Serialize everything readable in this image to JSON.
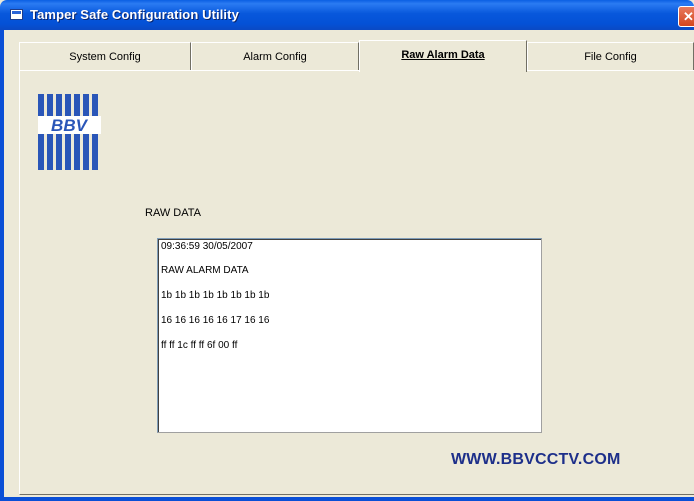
{
  "window": {
    "title": "Tamper Safe Configuration Utility",
    "close_glyph": "✕"
  },
  "tabs": [
    {
      "label": "System Config",
      "active": false
    },
    {
      "label": "Alarm Config",
      "active": false
    },
    {
      "label": "Raw Alarm Data",
      "active": true
    },
    {
      "label": "File Config",
      "active": false
    }
  ],
  "logo": {
    "text": "BBV"
  },
  "raw": {
    "label": "RAW DATA",
    "lines": [
      "09:36:59 30/05/2007",
      "RAW ALARM DATA",
      "1b 1b 1b 1b 1b 1b 1b 1b",
      "16 16 16 16 16 17 16 16",
      "ff ff 1c ff ff 6f 00 ff"
    ]
  },
  "website": "WWW.BBVCCTV.COM",
  "colors": {
    "accent": "#0a4fd6",
    "website": "#1d2f8a",
    "logo_blue": "#2a56b8"
  }
}
